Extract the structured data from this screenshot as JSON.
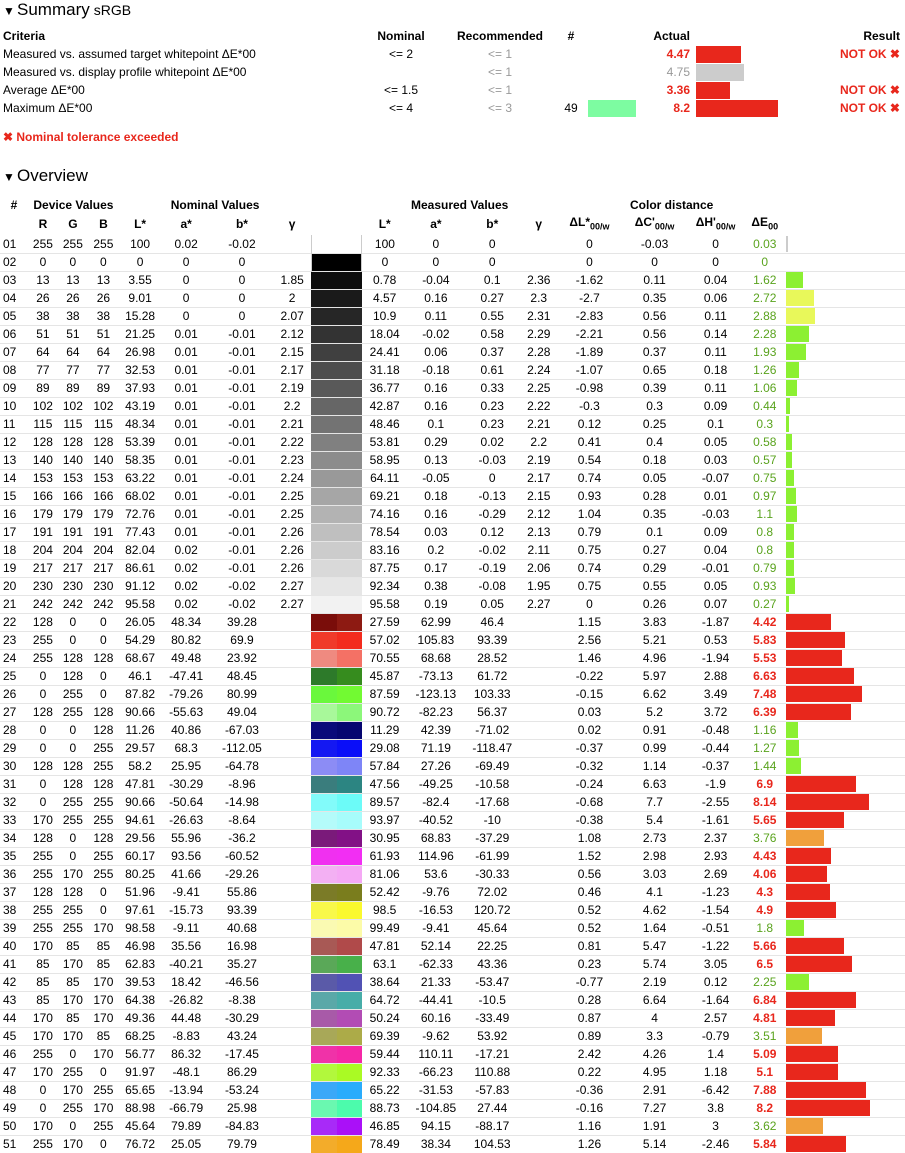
{
  "summary": {
    "title": "Summary",
    "profile": "sRGB",
    "headers": {
      "criteria": "Criteria",
      "nominal": "Nominal",
      "recommended": "Recommended",
      "count": "#",
      "actual": "Actual",
      "result": "Result"
    },
    "rows": [
      {
        "criteria": "Measured vs. assumed target whitepoint ΔE*00",
        "nominal": "<= 2",
        "recommended": "<= 1",
        "count": "",
        "actual": "4.47",
        "actual_state": "fail",
        "bar_color": "#e8271c",
        "bar_value": 4.47,
        "result": "NOT OK ✖"
      },
      {
        "criteria": "Measured vs. display profile whitepoint ΔE*00",
        "nominal": "",
        "recommended": "<= 1",
        "count": "",
        "actual": "4.75",
        "actual_state": "info",
        "bar_color": "#cccccc",
        "bar_value": 4.75,
        "result": ""
      },
      {
        "criteria": "Average ΔE*00",
        "nominal": "<= 1.5",
        "recommended": "<= 1",
        "count": "",
        "actual": "3.36",
        "actual_state": "fail",
        "bar_color": "#e8271c",
        "bar_value": 3.36,
        "result": "NOT OK ✖"
      },
      {
        "criteria": "Maximum ΔE*00",
        "nominal": "<= 4",
        "recommended": "<= 3",
        "count": "49",
        "actual": "8.2",
        "actual_state": "fail",
        "bar_color": "#e8271c",
        "bar_value": 8.2,
        "swatch": "#7dfca1",
        "result": "NOT OK ✖"
      }
    ],
    "tolerance_message": "✖ Nominal tolerance exceeded"
  },
  "overview": {
    "title": "Overview",
    "group_headers": {
      "num": "#",
      "device": "Device Values",
      "nominal": "Nominal Values",
      "measured": "Measured Values",
      "distance": "Color distance"
    },
    "col_headers": [
      "R",
      "G",
      "B",
      "L*",
      "a*",
      "b*",
      "γ",
      "L*",
      "a*",
      "b*",
      "γ"
    ],
    "rows": [
      [
        "01",
        "255",
        "255",
        "255",
        "100",
        "0.02",
        "-0.02",
        "",
        "100",
        "0",
        "0",
        "",
        "0",
        "-0.03",
        "0",
        "0.03"
      ],
      [
        "02",
        "0",
        "0",
        "0",
        "0",
        "0",
        "0",
        "",
        "0",
        "0",
        "0",
        "",
        "0",
        "0",
        "0",
        "0"
      ],
      [
        "03",
        "13",
        "13",
        "13",
        "3.55",
        "0",
        "0",
        "1.85",
        "0.78",
        "-0.04",
        "0.1",
        "2.36",
        "-1.62",
        "0.11",
        "0.04",
        "1.62"
      ],
      [
        "04",
        "26",
        "26",
        "26",
        "9.01",
        "0",
        "0",
        "2",
        "4.57",
        "0.16",
        "0.27",
        "2.3",
        "-2.7",
        "0.35",
        "0.06",
        "2.72"
      ],
      [
        "05",
        "38",
        "38",
        "38",
        "15.28",
        "0",
        "0",
        "2.07",
        "10.9",
        "0.11",
        "0.55",
        "2.31",
        "-2.83",
        "0.56",
        "0.11",
        "2.88"
      ],
      [
        "06",
        "51",
        "51",
        "51",
        "21.25",
        "0.01",
        "-0.01",
        "2.12",
        "18.04",
        "-0.02",
        "0.58",
        "2.29",
        "-2.21",
        "0.56",
        "0.14",
        "2.28"
      ],
      [
        "07",
        "64",
        "64",
        "64",
        "26.98",
        "0.01",
        "-0.01",
        "2.15",
        "24.41",
        "0.06",
        "0.37",
        "2.28",
        "-1.89",
        "0.37",
        "0.11",
        "1.93"
      ],
      [
        "08",
        "77",
        "77",
        "77",
        "32.53",
        "0.01",
        "-0.01",
        "2.17",
        "31.18",
        "-0.18",
        "0.61",
        "2.24",
        "-1.07",
        "0.65",
        "0.18",
        "1.26"
      ],
      [
        "09",
        "89",
        "89",
        "89",
        "37.93",
        "0.01",
        "-0.01",
        "2.19",
        "36.77",
        "0.16",
        "0.33",
        "2.25",
        "-0.98",
        "0.39",
        "0.11",
        "1.06"
      ],
      [
        "10",
        "102",
        "102",
        "102",
        "43.19",
        "0.01",
        "-0.01",
        "2.2",
        "42.87",
        "0.16",
        "0.23",
        "2.22",
        "-0.3",
        "0.3",
        "0.09",
        "0.44"
      ],
      [
        "11",
        "115",
        "115",
        "115",
        "48.34",
        "0.01",
        "-0.01",
        "2.21",
        "48.46",
        "0.1",
        "0.23",
        "2.21",
        "0.12",
        "0.25",
        "0.1",
        "0.3"
      ],
      [
        "12",
        "128",
        "128",
        "128",
        "53.39",
        "0.01",
        "-0.01",
        "2.22",
        "53.81",
        "0.29",
        "0.02",
        "2.2",
        "0.41",
        "0.4",
        "0.05",
        "0.58"
      ],
      [
        "13",
        "140",
        "140",
        "140",
        "58.35",
        "0.01",
        "-0.01",
        "2.23",
        "58.95",
        "0.13",
        "-0.03",
        "2.19",
        "0.54",
        "0.18",
        "0.03",
        "0.57"
      ],
      [
        "14",
        "153",
        "153",
        "153",
        "63.22",
        "0.01",
        "-0.01",
        "2.24",
        "64.11",
        "-0.05",
        "0",
        "2.17",
        "0.74",
        "0.05",
        "-0.07",
        "0.75"
      ],
      [
        "15",
        "166",
        "166",
        "166",
        "68.02",
        "0.01",
        "-0.01",
        "2.25",
        "69.21",
        "0.18",
        "-0.13",
        "2.15",
        "0.93",
        "0.28",
        "0.01",
        "0.97"
      ],
      [
        "16",
        "179",
        "179",
        "179",
        "72.76",
        "0.01",
        "-0.01",
        "2.25",
        "74.16",
        "0.16",
        "-0.29",
        "2.12",
        "1.04",
        "0.35",
        "-0.03",
        "1.1"
      ],
      [
        "17",
        "191",
        "191",
        "191",
        "77.43",
        "0.01",
        "-0.01",
        "2.26",
        "78.54",
        "0.03",
        "0.12",
        "2.13",
        "0.79",
        "0.1",
        "0.09",
        "0.8"
      ],
      [
        "18",
        "204",
        "204",
        "204",
        "82.04",
        "0.02",
        "-0.01",
        "2.26",
        "83.16",
        "0.2",
        "-0.02",
        "2.11",
        "0.75",
        "0.27",
        "0.04",
        "0.8"
      ],
      [
        "19",
        "217",
        "217",
        "217",
        "86.61",
        "0.02",
        "-0.01",
        "2.26",
        "87.75",
        "0.17",
        "-0.19",
        "2.06",
        "0.74",
        "0.29",
        "-0.01",
        "0.79"
      ],
      [
        "20",
        "230",
        "230",
        "230",
        "91.12",
        "0.02",
        "-0.02",
        "2.27",
        "92.34",
        "0.38",
        "-0.08",
        "1.95",
        "0.75",
        "0.55",
        "0.05",
        "0.93"
      ],
      [
        "21",
        "242",
        "242",
        "242",
        "95.58",
        "0.02",
        "-0.02",
        "2.27",
        "95.58",
        "0.19",
        "0.05",
        "2.27",
        "0",
        "0.26",
        "0.07",
        "0.27"
      ],
      [
        "22",
        "128",
        "0",
        "0",
        "26.05",
        "48.34",
        "39.28",
        "",
        "27.59",
        "62.99",
        "46.4",
        "",
        "1.15",
        "3.83",
        "-1.87",
        "4.42"
      ],
      [
        "23",
        "255",
        "0",
        "0",
        "54.29",
        "80.82",
        "69.9",
        "",
        "57.02",
        "105.83",
        "93.39",
        "",
        "2.56",
        "5.21",
        "0.53",
        "5.83"
      ],
      [
        "24",
        "255",
        "128",
        "128",
        "68.67",
        "49.48",
        "23.92",
        "",
        "70.55",
        "68.68",
        "28.52",
        "",
        "1.46",
        "4.96",
        "-1.94",
        "5.53"
      ],
      [
        "25",
        "0",
        "128",
        "0",
        "46.1",
        "-47.41",
        "48.45",
        "",
        "45.87",
        "-73.13",
        "61.72",
        "",
        "-0.22",
        "5.97",
        "2.88",
        "6.63"
      ],
      [
        "26",
        "0",
        "255",
        "0",
        "87.82",
        "-79.26",
        "80.99",
        "",
        "87.59",
        "-123.13",
        "103.33",
        "",
        "-0.15",
        "6.62",
        "3.49",
        "7.48"
      ],
      [
        "27",
        "128",
        "255",
        "128",
        "90.66",
        "-55.63",
        "49.04",
        "",
        "90.72",
        "-82.23",
        "56.37",
        "",
        "0.03",
        "5.2",
        "3.72",
        "6.39"
      ],
      [
        "28",
        "0",
        "0",
        "128",
        "11.26",
        "40.86",
        "-67.03",
        "",
        "11.29",
        "42.39",
        "-71.02",
        "",
        "0.02",
        "0.91",
        "-0.48",
        "1.16"
      ],
      [
        "29",
        "0",
        "0",
        "255",
        "29.57",
        "68.3",
        "-112.05",
        "",
        "29.08",
        "71.19",
        "-118.47",
        "",
        "-0.37",
        "0.99",
        "-0.44",
        "1.27"
      ],
      [
        "30",
        "128",
        "128",
        "255",
        "58.2",
        "25.95",
        "-64.78",
        "",
        "57.84",
        "27.26",
        "-69.49",
        "",
        "-0.32",
        "1.14",
        "-0.37",
        "1.44"
      ],
      [
        "31",
        "0",
        "128",
        "128",
        "47.81",
        "-30.29",
        "-8.96",
        "",
        "47.56",
        "-49.25",
        "-10.58",
        "",
        "-0.24",
        "6.63",
        "-1.9",
        "6.9"
      ],
      [
        "32",
        "0",
        "255",
        "255",
        "90.66",
        "-50.64",
        "-14.98",
        "",
        "89.57",
        "-82.4",
        "-17.68",
        "",
        "-0.68",
        "7.7",
        "-2.55",
        "8.14"
      ],
      [
        "33",
        "170",
        "255",
        "255",
        "94.61",
        "-26.63",
        "-8.64",
        "",
        "93.97",
        "-40.52",
        "-10",
        "",
        "-0.38",
        "5.4",
        "-1.61",
        "5.65"
      ],
      [
        "34",
        "128",
        "0",
        "128",
        "29.56",
        "55.96",
        "-36.2",
        "",
        "30.95",
        "68.83",
        "-37.29",
        "",
        "1.08",
        "2.73",
        "2.37",
        "3.76"
      ],
      [
        "35",
        "255",
        "0",
        "255",
        "60.17",
        "93.56",
        "-60.52",
        "",
        "61.93",
        "114.96",
        "-61.99",
        "",
        "1.52",
        "2.98",
        "2.93",
        "4.43"
      ],
      [
        "36",
        "255",
        "170",
        "255",
        "80.25",
        "41.66",
        "-29.26",
        "",
        "81.06",
        "53.6",
        "-30.33",
        "",
        "0.56",
        "3.03",
        "2.69",
        "4.06"
      ],
      [
        "37",
        "128",
        "128",
        "0",
        "51.96",
        "-9.41",
        "55.86",
        "",
        "52.42",
        "-9.76",
        "72.02",
        "",
        "0.46",
        "4.1",
        "-1.23",
        "4.3"
      ],
      [
        "38",
        "255",
        "255",
        "0",
        "97.61",
        "-15.73",
        "93.39",
        "",
        "98.5",
        "-16.53",
        "120.72",
        "",
        "0.52",
        "4.62",
        "-1.54",
        "4.9"
      ],
      [
        "39",
        "255",
        "255",
        "170",
        "98.58",
        "-9.11",
        "40.68",
        "",
        "99.49",
        "-9.41",
        "45.64",
        "",
        "0.52",
        "1.64",
        "-0.51",
        "1.8"
      ],
      [
        "40",
        "170",
        "85",
        "85",
        "46.98",
        "35.56",
        "16.98",
        "",
        "47.81",
        "52.14",
        "22.25",
        "",
        "0.81",
        "5.47",
        "-1.22",
        "5.66"
      ],
      [
        "41",
        "85",
        "170",
        "85",
        "62.83",
        "-40.21",
        "35.27",
        "",
        "63.1",
        "-62.33",
        "43.36",
        "",
        "0.23",
        "5.74",
        "3.05",
        "6.5"
      ],
      [
        "42",
        "85",
        "85",
        "170",
        "39.53",
        "18.42",
        "-46.56",
        "",
        "38.64",
        "21.33",
        "-53.47",
        "",
        "-0.77",
        "2.19",
        "0.12",
        "2.25"
      ],
      [
        "43",
        "85",
        "170",
        "170",
        "64.38",
        "-26.82",
        "-8.38",
        "",
        "64.72",
        "-44.41",
        "-10.5",
        "",
        "0.28",
        "6.64",
        "-1.64",
        "6.84"
      ],
      [
        "44",
        "170",
        "85",
        "170",
        "49.36",
        "44.48",
        "-30.29",
        "",
        "50.24",
        "60.16",
        "-33.49",
        "",
        "0.87",
        "4",
        "2.57",
        "4.81"
      ],
      [
        "45",
        "170",
        "170",
        "85",
        "68.25",
        "-8.83",
        "43.24",
        "",
        "69.39",
        "-9.62",
        "53.92",
        "",
        "0.89",
        "3.3",
        "-0.79",
        "3.51"
      ],
      [
        "46",
        "255",
        "0",
        "170",
        "56.77",
        "86.32",
        "-17.45",
        "",
        "59.44",
        "110.11",
        "-17.21",
        "",
        "2.42",
        "4.26",
        "1.4",
        "5.09"
      ],
      [
        "47",
        "170",
        "255",
        "0",
        "91.97",
        "-48.1",
        "86.29",
        "",
        "92.33",
        "-66.23",
        "110.88",
        "",
        "0.22",
        "4.95",
        "1.18",
        "5.1"
      ],
      [
        "48",
        "0",
        "170",
        "255",
        "65.65",
        "-13.94",
        "-53.24",
        "",
        "65.22",
        "-31.53",
        "-57.83",
        "",
        "-0.36",
        "2.91",
        "-6.42",
        "7.88"
      ],
      [
        "49",
        "0",
        "255",
        "170",
        "88.98",
        "-66.79",
        "25.98",
        "",
        "88.73",
        "-104.85",
        "27.44",
        "",
        "-0.16",
        "7.27",
        "3.8",
        "8.2"
      ],
      [
        "50",
        "170",
        "0",
        "255",
        "45.64",
        "79.89",
        "-84.83",
        "",
        "46.85",
        "94.15",
        "-88.17",
        "",
        "1.16",
        "1.91",
        "3",
        "3.62"
      ],
      [
        "51",
        "255",
        "170",
        "0",
        "76.72",
        "25.05",
        "79.79",
        "",
        "78.49",
        "38.34",
        "104.53",
        "",
        "1.26",
        "5.14",
        "-2.46",
        "5.84"
      ]
    ],
    "swatches": [
      [
        "#ffffff",
        "#ffffff"
      ],
      [
        "#000000",
        "#000000"
      ],
      [
        "#0d0d0d",
        "#0d0d0d"
      ],
      [
        "#1a1a1a",
        "#1a1a1a"
      ],
      [
        "#262626",
        "#262626"
      ],
      [
        "#333333",
        "#333333"
      ],
      [
        "#404040",
        "#404040"
      ],
      [
        "#4d4d4d",
        "#4d4d4d"
      ],
      [
        "#595959",
        "#595959"
      ],
      [
        "#666666",
        "#666666"
      ],
      [
        "#737373",
        "#737373"
      ],
      [
        "#808080",
        "#808080"
      ],
      [
        "#8c8c8c",
        "#8c8c8c"
      ],
      [
        "#999999",
        "#999999"
      ],
      [
        "#a6a6a6",
        "#a6a6a6"
      ],
      [
        "#b3b3b3",
        "#b3b3b3"
      ],
      [
        "#bfbfbf",
        "#bfbfbf"
      ],
      [
        "#cccccc",
        "#cccccc"
      ],
      [
        "#d9d9d9",
        "#d9d9d9"
      ],
      [
        "#e6e6e6",
        "#e6e6e6"
      ],
      [
        "#f2f2f2",
        "#f2f2f2"
      ],
      [
        "#7a0d0a",
        "#8d1a12"
      ],
      [
        "#f03a2a",
        "#f32c1e"
      ],
      [
        "#ef8a80",
        "#f47165"
      ],
      [
        "#2d7a2a",
        "#368c1e"
      ],
      [
        "#6af83c",
        "#72fa32"
      ],
      [
        "#a8f89a",
        "#8cf77a"
      ],
      [
        "#0a0a7a",
        "#060670"
      ],
      [
        "#1418f2",
        "#0a0ef8"
      ],
      [
        "#8c8cf5",
        "#7e85f7"
      ],
      [
        "#3a7d7d",
        "#2c8582"
      ],
      [
        "#82fbfa",
        "#6cfbf8"
      ],
      [
        "#b4fbfa",
        "#a7fcfb"
      ],
      [
        "#7a1a7a",
        "#821186"
      ],
      [
        "#f030f0",
        "#f22ef3"
      ],
      [
        "#f3b0f3",
        "#f5a9f5"
      ],
      [
        "#7b7b27",
        "#7a7d1d"
      ],
      [
        "#f8f84a",
        "#faf92e"
      ],
      [
        "#fafab2",
        "#fcfba8"
      ],
      [
        "#a85955",
        "#b04a4a"
      ],
      [
        "#5aa858",
        "#48b04a"
      ],
      [
        "#5a5aa8",
        "#5152b4"
      ],
      [
        "#5aa8a8",
        "#47ada8"
      ],
      [
        "#a85aa8",
        "#b24cb4"
      ],
      [
        "#a8a858",
        "#acab48"
      ],
      [
        "#f032a8",
        "#f528a6"
      ],
      [
        "#b2f83c",
        "#aafa24"
      ],
      [
        "#3aa8f8",
        "#2aacfc"
      ],
      [
        "#6af8b0",
        "#4cfbac"
      ],
      [
        "#a82af8",
        "#aa10f8"
      ],
      [
        "#f3ac2a",
        "#f5a81a"
      ]
    ],
    "bar_colors": {
      "good": "#8cf032",
      "warn": "#e8f85a",
      "fail": "#e8271c",
      "mid": "#f0a03c"
    }
  }
}
